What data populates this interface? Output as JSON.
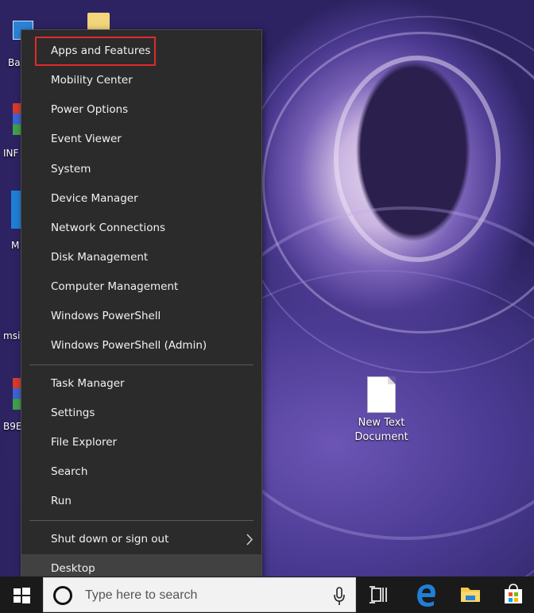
{
  "desktop": {
    "icons": [
      {
        "label": "Bat"
      },
      {
        "label": "INF"
      },
      {
        "label": "M"
      },
      {
        "label": "msi"
      },
      {
        "label": "B9E"
      },
      {
        "label": "New Text Document"
      }
    ]
  },
  "context_menu": {
    "groups": [
      {
        "items": [
          {
            "label": "Apps and Features",
            "highlighted": true
          },
          {
            "label": "Mobility Center"
          },
          {
            "label": "Power Options"
          },
          {
            "label": "Event Viewer"
          },
          {
            "label": "System"
          },
          {
            "label": "Device Manager"
          },
          {
            "label": "Network Connections"
          },
          {
            "label": "Disk Management"
          },
          {
            "label": "Computer Management"
          },
          {
            "label": "Windows PowerShell"
          },
          {
            "label": "Windows PowerShell (Admin)"
          }
        ]
      },
      {
        "items": [
          {
            "label": "Task Manager"
          },
          {
            "label": "Settings"
          },
          {
            "label": "File Explorer"
          },
          {
            "label": "Search"
          },
          {
            "label": "Run"
          }
        ]
      },
      {
        "items": [
          {
            "label": "Shut down or sign out",
            "submenu": true
          },
          {
            "label": "Desktop",
            "hovered": true
          }
        ]
      }
    ]
  },
  "taskbar": {
    "search_placeholder": "Type here to search"
  },
  "colors": {
    "menu_bg": "#2b2b2b",
    "menu_text": "#f2f2f2",
    "highlight_border": "#e02a2a",
    "hover_bg": "#414141",
    "taskbar_bg": "#1a1a1a"
  }
}
